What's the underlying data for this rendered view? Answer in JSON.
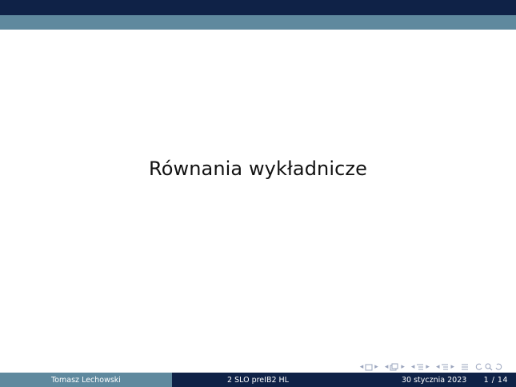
{
  "slide": {
    "title": "Równania wykładnicze"
  },
  "footer": {
    "author": "Tomasz Lechowski",
    "course": "2 SLO preIB2 HL",
    "date": "30 stycznia 2023",
    "page": "1 / 14"
  },
  "nav": {
    "icons": [
      "nav-frame-icon",
      "nav-subsection-icon",
      "nav-section-icon",
      "nav-document-icon",
      "nav-search-icon"
    ]
  },
  "colors": {
    "header_dark": "#0f2247",
    "header_light": "#5f899e",
    "nav_symbols": "#9aa4bd"
  }
}
